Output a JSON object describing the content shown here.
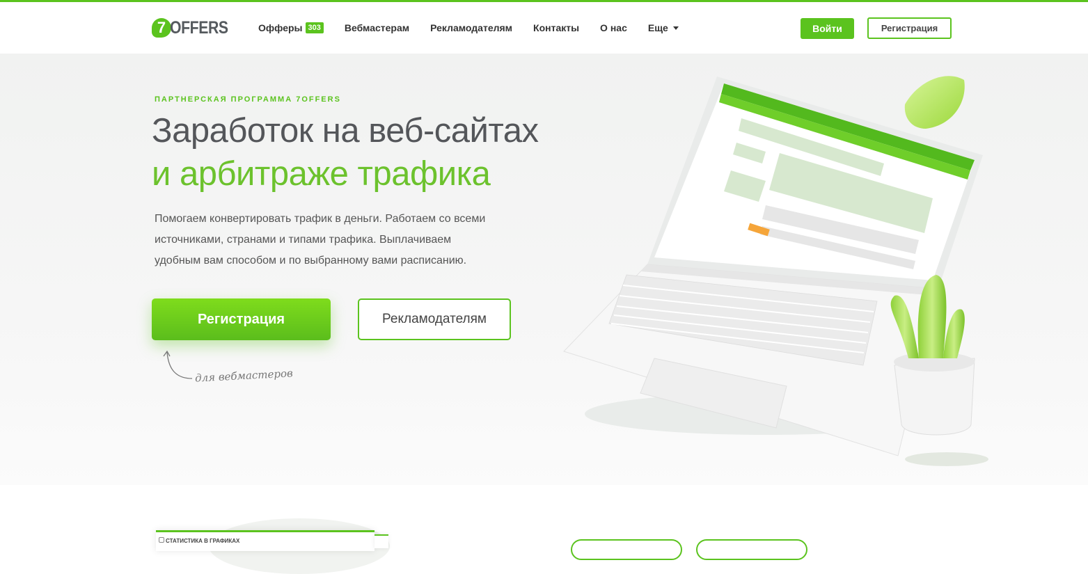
{
  "header": {
    "logo_mark": "7",
    "logo_text": "OFFERS",
    "nav": [
      {
        "label": "Офферы",
        "badge": "303"
      },
      {
        "label": "Вебмастерам"
      },
      {
        "label": "Рекламодателям"
      },
      {
        "label": "Контакты"
      },
      {
        "label": "О нас"
      },
      {
        "label": "Еще"
      }
    ],
    "login_label": "Войти",
    "register_label": "Регистрация"
  },
  "hero": {
    "kicker": "ПАРТНЕРСКАЯ ПРОГРАММА 7OFFERS",
    "title_line1": "Заработок на веб-сайтах",
    "title_line2": "и арбитраже трафика",
    "description": [
      "Помогаем конвертировать трафик в деньги. Работаем со всеми",
      "источниками, странами и типами трафика. Выплачиваем",
      "удобным вам способом и по выбранному вами расписанию."
    ],
    "register_button": "Регистрация",
    "advertisers_button": "Рекламодателям",
    "register_note": "для вебмастеров"
  },
  "colors": {
    "accent": "#5bc31e",
    "title_gray": "#54565a",
    "title_green": "#6cc22d"
  },
  "bottom": {
    "card_title": "Статистика в графиках"
  }
}
